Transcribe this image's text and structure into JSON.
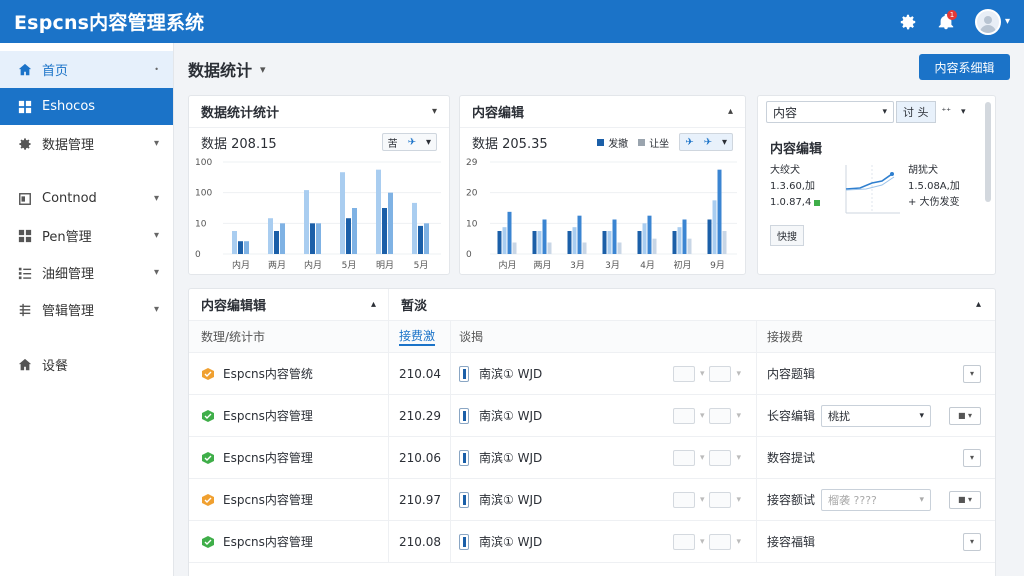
{
  "header": {
    "app_title": "Espcns内容管理系统",
    "notification_count": "1"
  },
  "sidebar": {
    "items": [
      {
        "label": "首页",
        "icon": "home-icon"
      },
      {
        "label": "Eshocos",
        "icon": "grid-icon"
      },
      {
        "label": "数据管理",
        "icon": "gear-icon"
      },
      {
        "label": "Contnod",
        "icon": "document-icon"
      },
      {
        "label": "Pen管理",
        "icon": "grid-icon"
      },
      {
        "label": "油细管理",
        "icon": "list-icon"
      },
      {
        "label": "管辑管理",
        "icon": "list-icon"
      },
      {
        "label": "设餐",
        "icon": "home-icon"
      }
    ]
  },
  "main": {
    "page_title": "数据统计",
    "primary_button": "内容系细辑",
    "card1": {
      "title": "数据统计统计",
      "stat": "数据 208.15",
      "ctrl_label": "苦",
      "chart_data": {
        "type": "bar",
        "categories": [
          "内月",
          "两月",
          "内月",
          "5月",
          "明月",
          "5月"
        ],
        "ytick_labels": [
          "0",
          "10",
          "100",
          "100"
        ],
        "series": [
          {
            "values": [
              9,
              14,
              25,
              32,
              33,
              20
            ]
          },
          {
            "values": [
              5,
              9,
              12,
              14,
              18,
              11
            ]
          },
          {
            "values": [
              5,
              12,
              12,
              18,
              24,
              12
            ]
          }
        ]
      }
    },
    "card2": {
      "title": "内容编辑",
      "stat": "数据 205.35",
      "legend": [
        "发撤",
        "让坐"
      ],
      "chart_data": {
        "type": "bar",
        "categories": [
          "内月",
          "两月",
          "3月",
          "3月",
          "4月",
          "初月",
          "9月"
        ],
        "ytick_labels": [
          "0",
          "10",
          "20",
          "29"
        ],
        "series": [
          {
            "values": [
              6,
              6,
              6,
              6,
              6,
              6,
              9
            ]
          },
          {
            "values": [
              7,
              6,
              7,
              6,
              8,
              7,
              14
            ]
          },
          {
            "values": [
              11,
              9,
              10,
              9,
              10,
              9,
              22
            ]
          },
          {
            "values": [
              3,
              3,
              3,
              3,
              4,
              4,
              6
            ]
          }
        ]
      }
    },
    "card3": {
      "select_value": "内容",
      "btn_label": "讨 头",
      "title": "内容编辑",
      "left_lines": [
        "大绞犬",
        "1.3.60,加",
        "1.0.87,4"
      ],
      "right_lines": [
        "胡犹犬",
        "1.5.08A,加",
        "+ 大伤发变"
      ],
      "footer_btn": "快搜"
    },
    "table": {
      "head_left": "内容编辑辑",
      "head_right": "暂淡",
      "columns": [
        "数理/统计市",
        "接费激",
        "谈揭",
        "接拨费"
      ],
      "rows": [
        {
          "name": "Espcns内容管统",
          "hex_color": "#f0a030",
          "value": "210.04",
          "code": "南滨① WJD",
          "status": "内容题辑",
          "select": ""
        },
        {
          "name": "Espcns内容管理",
          "hex_color": "#3fae49",
          "value": "210.29",
          "code": "南滨① WJD",
          "status": "长容编辑",
          "select": "桃扰"
        },
        {
          "name": "Espcns内容管理",
          "hex_color": "#3fae49",
          "value": "210.06",
          "code": "南滨① WJD",
          "status": "数容提试",
          "select": ""
        },
        {
          "name": "Espcns内容管理",
          "hex_color": "#f0a030",
          "value": "210.97",
          "code": "南滨① WJD",
          "status": "接容额试",
          "select": "榴袭 ????"
        },
        {
          "name": "Espcns内容管理",
          "hex_color": "#3fae49",
          "value": "210.08",
          "code": "南滨① WJD",
          "status": "接容福辑",
          "select": ""
        }
      ]
    }
  }
}
